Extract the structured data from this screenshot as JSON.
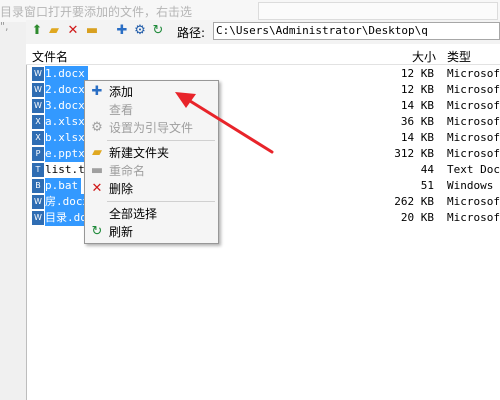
{
  "hint": {
    "line1": "目录窗口打开要添加的文件，右击选",
    "line2": "\","
  },
  "toolbar": {
    "path_label": "路径:",
    "path_value": "C:\\Users\\Administrator\\Desktop\\q",
    "icons": [
      "up-icon",
      "new-folder-icon",
      "delete-icon",
      "folder-icon",
      "add-icon",
      "settings-icon",
      "refresh-icon"
    ]
  },
  "columns": {
    "name": "文件名",
    "size": "大小",
    "type": "类型"
  },
  "files": [
    {
      "name": "1.docx",
      "size": "12 KB",
      "type": "Microsoft",
      "icon": "W",
      "selected": true
    },
    {
      "name": "2.docx",
      "size": "12 KB",
      "type": "Microsoft",
      "icon": "W",
      "selected": true
    },
    {
      "name": "3.docx",
      "size": "14 KB",
      "type": "Microsoft",
      "icon": "W",
      "selected": true
    },
    {
      "name": "a.xlsx",
      "size": "36 KB",
      "type": "Microsoft",
      "icon": "X",
      "selected": true
    },
    {
      "name": "b.xlsx",
      "size": "14 KB",
      "type": "Microsoft",
      "icon": "X",
      "selected": true
    },
    {
      "name": "e.pptx",
      "size": "312 KB",
      "type": "Microsoft",
      "icon": "P",
      "selected": true
    },
    {
      "name": "list.tx",
      "size": "44",
      "type": "Text Docu",
      "icon": "T",
      "selected": false
    },
    {
      "name": "p.bat",
      "size": "51",
      "type": "Windows B",
      "icon": "B",
      "selected": true
    },
    {
      "name": "房.docx",
      "size": "262 KB",
      "type": "Microsoft",
      "icon": "W",
      "selected": true
    },
    {
      "name": "目录.do",
      "size": "20 KB",
      "type": "Microsoft",
      "icon": "W",
      "selected": true
    }
  ],
  "menu": {
    "add": "添加",
    "view": "查看",
    "set_guide": "设置为引导文件",
    "new_folder": "新建文件夹",
    "rename": "重命名",
    "delete": "删除",
    "select_all": "全部选择",
    "refresh": "刷新"
  },
  "colors": {
    "selection": "#3399ff",
    "arrow": "#e8242a"
  }
}
